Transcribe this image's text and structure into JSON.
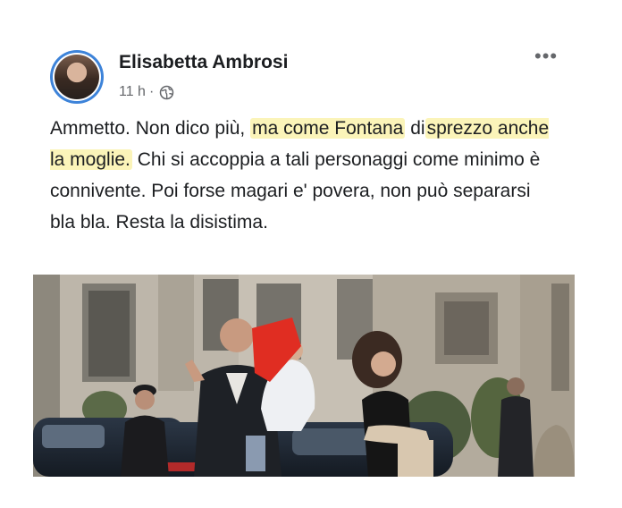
{
  "post": {
    "author": "Elisabetta Ambrosi",
    "time": "11 h",
    "separator": "·",
    "more_glyph": "•••",
    "text": {
      "t1": "Ammetto. Non dico più, ",
      "hl1": "ma come Fontana",
      "t2": " di",
      "hl2": "sprezzo anche la moglie.",
      "t3": " Chi si accoppia a tali personaggi come minimo è connivente. Poi forse magari e' povera, non può separarsi bla bla. Resta la disistima."
    },
    "icons": {
      "avatar": "profile-photo",
      "audience": "globe-icon",
      "menu": "more-options-icon"
    },
    "colors": {
      "highlight": "#fbf4b9",
      "avatar_ring": "#3d83d9",
      "meta_text": "#65676b"
    }
  }
}
